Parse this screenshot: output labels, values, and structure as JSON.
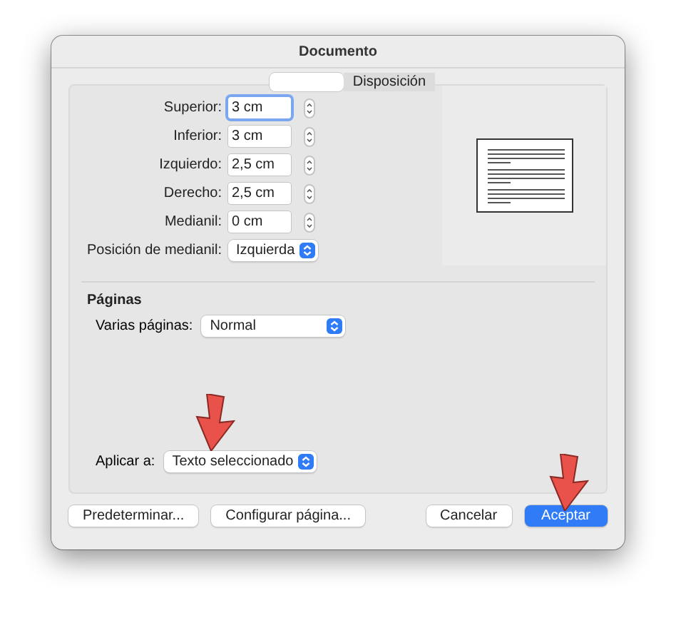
{
  "window": {
    "title": "Documento"
  },
  "tabs": [
    {
      "selected": true
    },
    {
      "label": "Disposición",
      "selected": false
    }
  ],
  "margins": [
    {
      "label": "Superior:",
      "value": "3 cm",
      "focused": true
    },
    {
      "label": "Inferior:",
      "value": "3 cm",
      "focused": false
    },
    {
      "label": "Izquierdo:",
      "value": "2,5 cm",
      "focused": false
    },
    {
      "label": "Derecho:",
      "value": "2,5 cm",
      "focused": false
    },
    {
      "label": "Medianil:",
      "value": "0 cm",
      "focused": false
    }
  ],
  "gutter_position": {
    "label": "Posición de medianil:",
    "value": "Izquierda"
  },
  "pages": {
    "heading": "Páginas",
    "label": "Varias páginas:",
    "value": "Normal"
  },
  "apply_to": {
    "label": "Aplicar a:",
    "value": "Texto seleccionado"
  },
  "buttons_left": [
    {
      "label": "Predeterminar...",
      "default": false
    },
    {
      "label": "Configurar página...",
      "default": false
    }
  ],
  "buttons_right": [
    {
      "label": "Cancelar",
      "default": false
    },
    {
      "label": "Aceptar",
      "default": true
    }
  ]
}
